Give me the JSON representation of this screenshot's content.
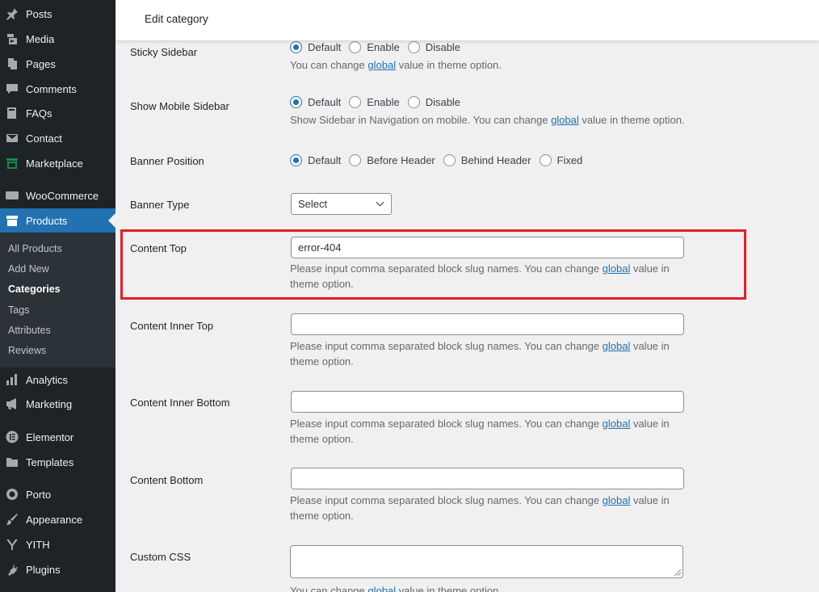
{
  "sidebar": {
    "items": [
      {
        "label": "Posts",
        "icon": "pin-icon"
      },
      {
        "label": "Media",
        "icon": "media-icon"
      },
      {
        "label": "Pages",
        "icon": "pages-icon"
      },
      {
        "label": "Comments",
        "icon": "comment-icon"
      },
      {
        "label": "FAQs",
        "icon": "book-icon"
      },
      {
        "label": "Contact",
        "icon": "mail-icon"
      },
      {
        "label": "Marketplace",
        "icon": "marketplace-icon"
      },
      {
        "label": "WooCommerce",
        "icon": "woo-icon"
      },
      {
        "label": "Products",
        "icon": "archive-icon"
      },
      {
        "label": "Analytics",
        "icon": "bar-chart-icon"
      },
      {
        "label": "Marketing",
        "icon": "megaphone-icon"
      },
      {
        "label": "Elementor",
        "icon": "elementor-icon"
      },
      {
        "label": "Templates",
        "icon": "folder-icon"
      },
      {
        "label": "Porto",
        "icon": "porto-icon"
      },
      {
        "label": "Appearance",
        "icon": "brush-icon"
      },
      {
        "label": "YITH",
        "icon": "yith-icon"
      },
      {
        "label": "Plugins",
        "icon": "plug-icon"
      }
    ],
    "submenu": [
      "All Products",
      "Add New",
      "Categories",
      "Tags",
      "Attributes",
      "Reviews"
    ]
  },
  "header": {
    "title": "Edit category"
  },
  "fields": {
    "sticky_sidebar": {
      "label": "Sticky Sidebar",
      "options": [
        "Default",
        "Enable",
        "Disable"
      ],
      "selected": "Default",
      "desc_pre": "You can change ",
      "desc_link": "global",
      "desc_post": " value in theme option."
    },
    "show_mobile_sidebar": {
      "label": "Show Mobile Sidebar",
      "options": [
        "Default",
        "Enable",
        "Disable"
      ],
      "selected": "Default",
      "desc_pre": "Show Sidebar in Navigation on mobile. You can change ",
      "desc_link": "global",
      "desc_post": " value in theme option."
    },
    "banner_position": {
      "label": "Banner Position",
      "options": [
        "Default",
        "Before Header",
        "Behind Header",
        "Fixed"
      ],
      "selected": "Default"
    },
    "banner_type": {
      "label": "Banner Type",
      "value": "Select"
    },
    "content_top": {
      "label": "Content Top",
      "value": "error-404",
      "desc_pre": "Please input comma separated block slug names. You can change ",
      "desc_link": "global",
      "desc_post": " value in theme option."
    },
    "content_inner_top": {
      "label": "Content Inner Top",
      "value": "",
      "desc_pre": "Please input comma separated block slug names. You can change ",
      "desc_link": "global",
      "desc_post": " value in theme option."
    },
    "content_inner_bottom": {
      "label": "Content Inner Bottom",
      "value": "",
      "desc_pre": "Please input comma separated block slug names. You can change ",
      "desc_link": "global",
      "desc_post": " value in theme option."
    },
    "content_bottom": {
      "label": "Content Bottom",
      "value": "",
      "desc_pre": "Please input comma separated block slug names. You can change ",
      "desc_link": "global",
      "desc_post": " value in theme option."
    },
    "custom_css": {
      "label": "Custom CSS",
      "desc_pre": "You can change ",
      "desc_link": "global",
      "desc_post": " value in theme option."
    }
  },
  "colors": {
    "accent": "#2271b1",
    "highlight": "#e31e24",
    "sidebar_bg": "#1d2327"
  }
}
